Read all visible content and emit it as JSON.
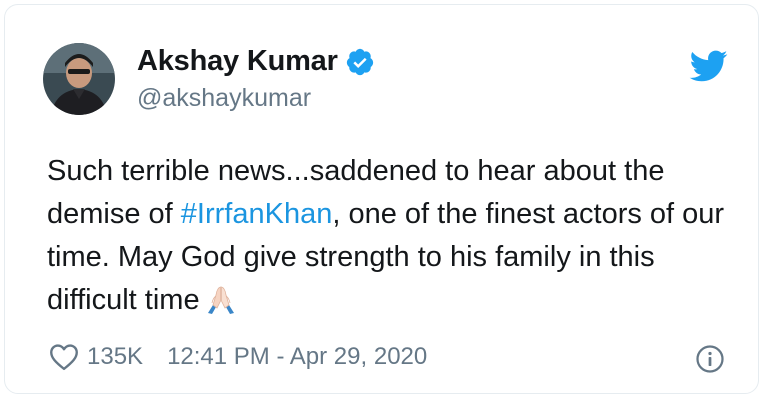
{
  "tweet": {
    "author": {
      "display_name": "Akshay Kumar",
      "handle": "@akshaykumar",
      "verified": true
    },
    "text_parts": {
      "line_start": "Such terrible news...saddened to hear about the demise of ",
      "hashtag": "#IrrfanKhan",
      "line_end": ", one of the finest actors of our time. May God give strength to his family in this difficult time"
    },
    "likes": "135K",
    "timestamp": "12:41 PM - Apr 29, 2020"
  },
  "icons": {
    "avatar": "profile-photo",
    "verified": "verified-badge-icon",
    "brand": "twitter-bird-icon",
    "emoji": "folded-hands-emoji",
    "like": "heart-icon",
    "info": "info-icon"
  },
  "colors": {
    "brand": "#1da1f2",
    "hashtag": "#1b95e0",
    "secondary_text": "#657786",
    "primary_text": "#14171a"
  }
}
